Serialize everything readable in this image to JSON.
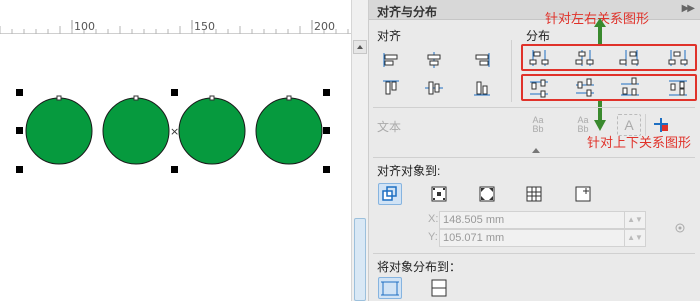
{
  "ruler": {
    "ticks": [
      "100",
      "150",
      "200"
    ]
  },
  "canvas": {
    "shape_fill": "#069a3e",
    "shape_count": 4,
    "center_marker": "×"
  },
  "panel": {
    "title": "对齐与分布",
    "expand_icon": "double-arrow-right-icon",
    "align_section": "对齐",
    "distribute_section": "分布",
    "text_section": "文本",
    "text_icon_labels": {
      "first": "Aa",
      "first_sub": "Bb",
      "second": "Aa",
      "second_sub": "Bb",
      "third": "A"
    },
    "align_to_section": "对齐对象到:",
    "x_label": "X:",
    "x_value": "148.505 mm",
    "y_label": "Y:",
    "y_value": "105.071 mm",
    "distribute_to_section": "将对象分布到：",
    "accent": "#e0322a"
  },
  "annotations": {
    "top": "针对左右关系图形",
    "bottom": "针对上下关系图形",
    "arrow_color": "#3a8a2e"
  }
}
